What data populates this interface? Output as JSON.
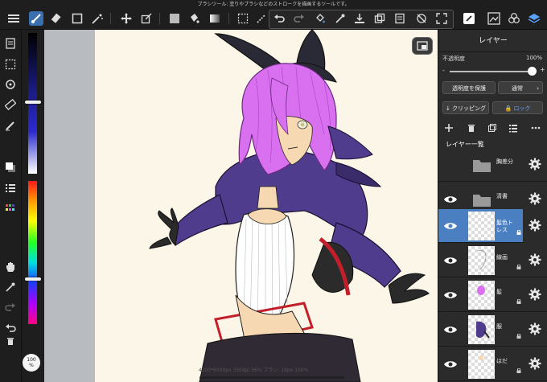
{
  "hint_text": "ブラシツール: 塗りやブラシなどのストロークを描画するツールです。",
  "zoom_badge": "100\n%",
  "status_text": "4200*6000px 350dpi 36% ブラシ: 19px 100%",
  "panel": {
    "title": "レイヤー",
    "opacity_label": "不透明度",
    "opacity_value": "100%",
    "protect_alpha_label": "透明度を保護",
    "blend_mode_label": "通常",
    "clipping_label": "クリッピング",
    "lock_label": "ロック",
    "list_title": "レイヤー一覧",
    "layers": [
      {
        "name": "胸差分",
        "type": "folder",
        "visible": false,
        "locked": false,
        "selected": false
      },
      {
        "name": "清書",
        "type": "folder",
        "visible": true,
        "locked": false,
        "selected": false
      },
      {
        "name": "髪色トレス",
        "type": "layer",
        "visible": true,
        "locked": true,
        "selected": true
      },
      {
        "name": "線画",
        "type": "layer",
        "visible": true,
        "locked": true,
        "selected": false
      },
      {
        "name": "髪",
        "type": "layer",
        "visible": true,
        "locked": true,
        "selected": false
      },
      {
        "name": "服",
        "type": "layer",
        "visible": true,
        "locked": true,
        "selected": false
      },
      {
        "name": "はだ",
        "type": "layer",
        "visible": true,
        "locked": true,
        "selected": false
      }
    ]
  },
  "colors": {
    "accent": "#4a7fc1",
    "hair": "#d970f0",
    "jacket": "#4f3c8c",
    "skin": "#f6d9b2",
    "paper": "#fbf6e8"
  }
}
